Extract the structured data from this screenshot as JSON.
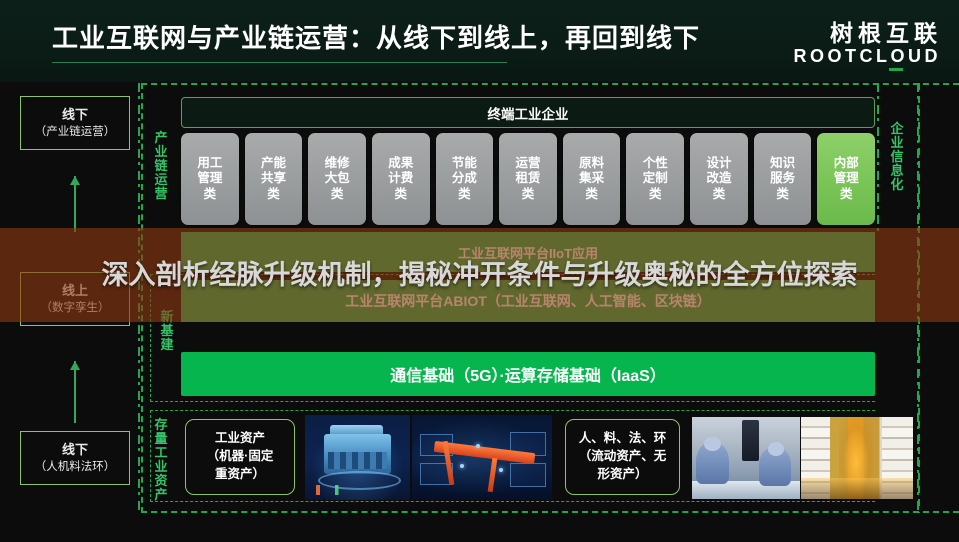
{
  "header": {
    "title": "工业互联网与产业链运营：从线下到线上，再回到线下",
    "logo_cn": "树根互联",
    "logo_en": "ROOTCLOUD"
  },
  "left_column": {
    "boxes": [
      {
        "line1": "线下",
        "line2": "（产业链运营）"
      },
      {
        "line1": "线上",
        "line2": "（数字孪生）"
      },
      {
        "line1": "线下",
        "line2": "（人机料法环）"
      }
    ]
  },
  "vertical_labels": {
    "chain_operation": "产业链运营",
    "new_infrastructure": "新基建",
    "stock_industrial_assets": "存量工业资产",
    "enterprise_informatization": "企业信息化"
  },
  "terminal_bar": {
    "label": "终端工业企业"
  },
  "service_cards": [
    {
      "line1": "用工",
      "line2": "管理",
      "line3": "类",
      "accent": false
    },
    {
      "line1": "产能",
      "line2": "共享",
      "line3": "类",
      "accent": false
    },
    {
      "line1": "维修",
      "line2": "大包",
      "line3": "类",
      "accent": false
    },
    {
      "line1": "成果",
      "line2": "计费",
      "line3": "类",
      "accent": false
    },
    {
      "line1": "节能",
      "line2": "分成",
      "line3": "类",
      "accent": false
    },
    {
      "line1": "运营",
      "line2": "租赁",
      "line3": "类",
      "accent": false
    },
    {
      "line1": "原料",
      "line2": "集采",
      "line3": "类",
      "accent": false
    },
    {
      "line1": "个性",
      "line2": "定制",
      "line3": "类",
      "accent": false
    },
    {
      "line1": "设计",
      "line2": "改造",
      "line3": "类",
      "accent": false
    },
    {
      "line1": "知识",
      "line2": "服务",
      "line3": "类",
      "accent": false
    },
    {
      "line1": "内部",
      "line2": "管理",
      "line3": "类",
      "accent": true
    }
  ],
  "platform_bars": {
    "iiot": "工业互联网平台IIoT应用",
    "abiot": "工业互联网平台ABIOT（工业互联网、人工智能、区块链）",
    "infra": "通信基础（5G）·运算存储基础（IaaS）"
  },
  "asset_boxes": [
    {
      "line1": "工业资产",
      "line2": "（机器·固定",
      "line3": "重资产）"
    },
    {
      "line1": "人、料、法、环",
      "line2": "（流动资产、无",
      "line3": "形资产）"
    }
  ],
  "photos": [
    {
      "name": "diesel-engine-digital-twin"
    },
    {
      "name": "crane-digital-twin"
    },
    {
      "name": "cleanroom-workers"
    },
    {
      "name": "yarn-spool-warehouse"
    }
  ],
  "overlay": {
    "text": "深入剖析经脉升级机制，揭秘冲开条件与升级奥秘的全方位探索"
  },
  "colors": {
    "brand_green": "#1fa84f",
    "bar_green": "#07b54e",
    "accent_card": "#79c457",
    "header_bg": "#0c2019",
    "overlay": "#8c3812"
  }
}
